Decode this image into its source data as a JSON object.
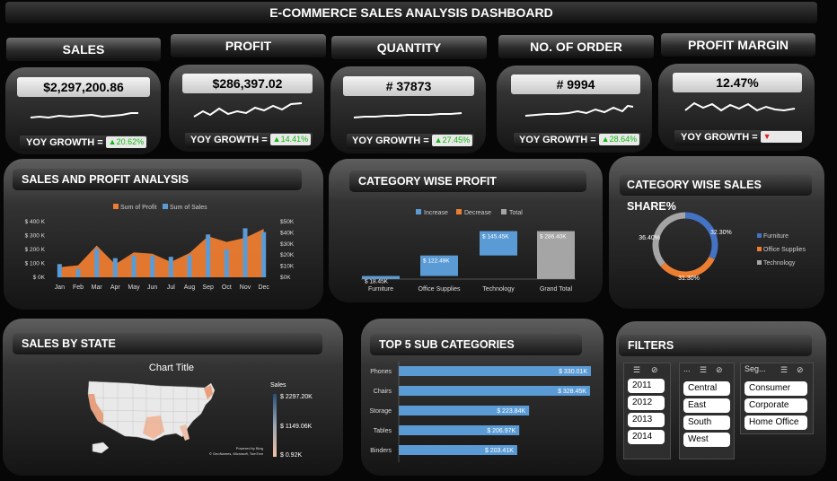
{
  "title": "E-COMMERCE SALES ANALYSIS DASHBOARD",
  "kpis": [
    {
      "label": "SALES",
      "value": "$2,297,200.86",
      "yoy_label": "YOY GROWTH =",
      "yoy": "20.62%",
      "direction": "up"
    },
    {
      "label": "PROFIT",
      "value": "$286,397.02",
      "yoy_label": "YOY GROWTH =",
      "yoy": "14.41%",
      "direction": "up"
    },
    {
      "label": "QUANTITY",
      "value": "# 37873",
      "yoy_label": "YOY GROWTH =",
      "yoy": "27.45%",
      "direction": "up"
    },
    {
      "label": "NO. OF ORDER",
      "value": "# 9994",
      "yoy_label": "YOY GROWTH =",
      "yoy": "28.64%",
      "direction": "up"
    },
    {
      "label": "PROFIT MARGIN",
      "value": "12.47%",
      "yoy_label": "YOY GROWTH =",
      "yoy": "",
      "direction": "down"
    }
  ],
  "panels": {
    "sales_profit": "SALES AND PROFIT ANALYSIS",
    "category_profit": "CATEGORY WISE PROFIT",
    "category_share": "CATEGORY WISE SALES SHARE%",
    "sales_state": "SALES BY STATE",
    "top5": "TOP 5 SUB CATEGORIES",
    "filters": "FILTERS"
  },
  "colors": {
    "profit": "#ed7d31",
    "sales": "#5b9bd5",
    "increase": "#5b9bd5",
    "decrease": "#ed7d31",
    "total": "#a5a5a5",
    "furniture": "#4472c4",
    "office": "#ed7d31",
    "technology": "#a5a5a5"
  },
  "chart_data": [
    {
      "type": "bar",
      "title": "",
      "categories": [
        "Jan",
        "Feb",
        "Mar",
        "Apr",
        "May",
        "Jun",
        "Jul",
        "Aug",
        "Sep",
        "Oct",
        "Nov",
        "Dec"
      ],
      "series": [
        {
          "name": "Sum of Profit",
          "kind": "area",
          "axis": "right",
          "values": [
            9100,
            10800,
            28500,
            11700,
            22400,
            21200,
            13800,
            21800,
            36900,
            31800,
            35500,
            43400
          ]
        },
        {
          "name": "Sum of Sales",
          "kind": "bar",
          "axis": "left",
          "values": [
            94900,
            59700,
            205000,
            137800,
            155000,
            152700,
            147200,
            159000,
            307600,
            200300,
            352500,
            325300
          ]
        }
      ],
      "left_ticks": [
        "$ 0K",
        "$ 100 K",
        "$ 200 K",
        "$ 300 K",
        "$ 400 K"
      ],
      "right_ticks": [
        "$0K",
        "$10K",
        "$20K",
        "$30K",
        "$40K",
        "$50K"
      ],
      "ylim_left": [
        0,
        400000
      ],
      "ylim_right": [
        0,
        50000
      ],
      "legend_position": "top"
    },
    {
      "type": "bar",
      "subtype": "waterfall",
      "title": "",
      "categories": [
        "Furniture",
        "Office Supplies",
        "Technology",
        "Grand Total"
      ],
      "values": [
        18.45,
        122.49,
        145.45,
        286.4
      ],
      "labels": [
        "$ 18.45K",
        "$ 122.49K",
        "$ 145.45K",
        "$ 286.40K"
      ],
      "legend": [
        "Increase",
        "Decrease",
        "Total"
      ],
      "legend_position": "top",
      "ylim": [
        0,
        300
      ]
    },
    {
      "type": "pie",
      "subtype": "doughnut",
      "title": "",
      "categories": [
        "Furniture",
        "Office Supplies",
        "Technology"
      ],
      "values": [
        32.3,
        31.3,
        36.4
      ],
      "labels": [
        "32.30%",
        "31.30%",
        "36.40%"
      ],
      "legend_position": "right"
    },
    {
      "type": "heatmap",
      "subtype": "map",
      "title": "Chart Title",
      "legend_title": "Sales",
      "scale_labels": [
        "$ 2297.20K",
        "$ 1149.06K",
        "$ 0.92K"
      ],
      "attribution_1": "Powered by Bing",
      "attribution_2": "© GeoNames, Microsoft, TomTom"
    },
    {
      "type": "bar",
      "subtype": "horizontal",
      "title": "",
      "categories": [
        "Phones",
        "Chairs",
        "Storage",
        "Tables",
        "Binders"
      ],
      "values": [
        330.01,
        328.45,
        223.84,
        206.97,
        203.41
      ],
      "labels": [
        "$ 330.01K",
        "$ 328.45K",
        "$ 223.84K",
        "$ 206.97K",
        "$ 203.41K"
      ],
      "xlim": [
        0,
        330.01
      ]
    }
  ],
  "filters": {
    "years": [
      "2011",
      "2012",
      "2013",
      "2014"
    ],
    "regions_title": "...",
    "regions": [
      "Central",
      "East",
      "South",
      "West"
    ],
    "segments_title": "Seg...",
    "segments": [
      "Consumer",
      "Corporate",
      "Home Office"
    ]
  }
}
